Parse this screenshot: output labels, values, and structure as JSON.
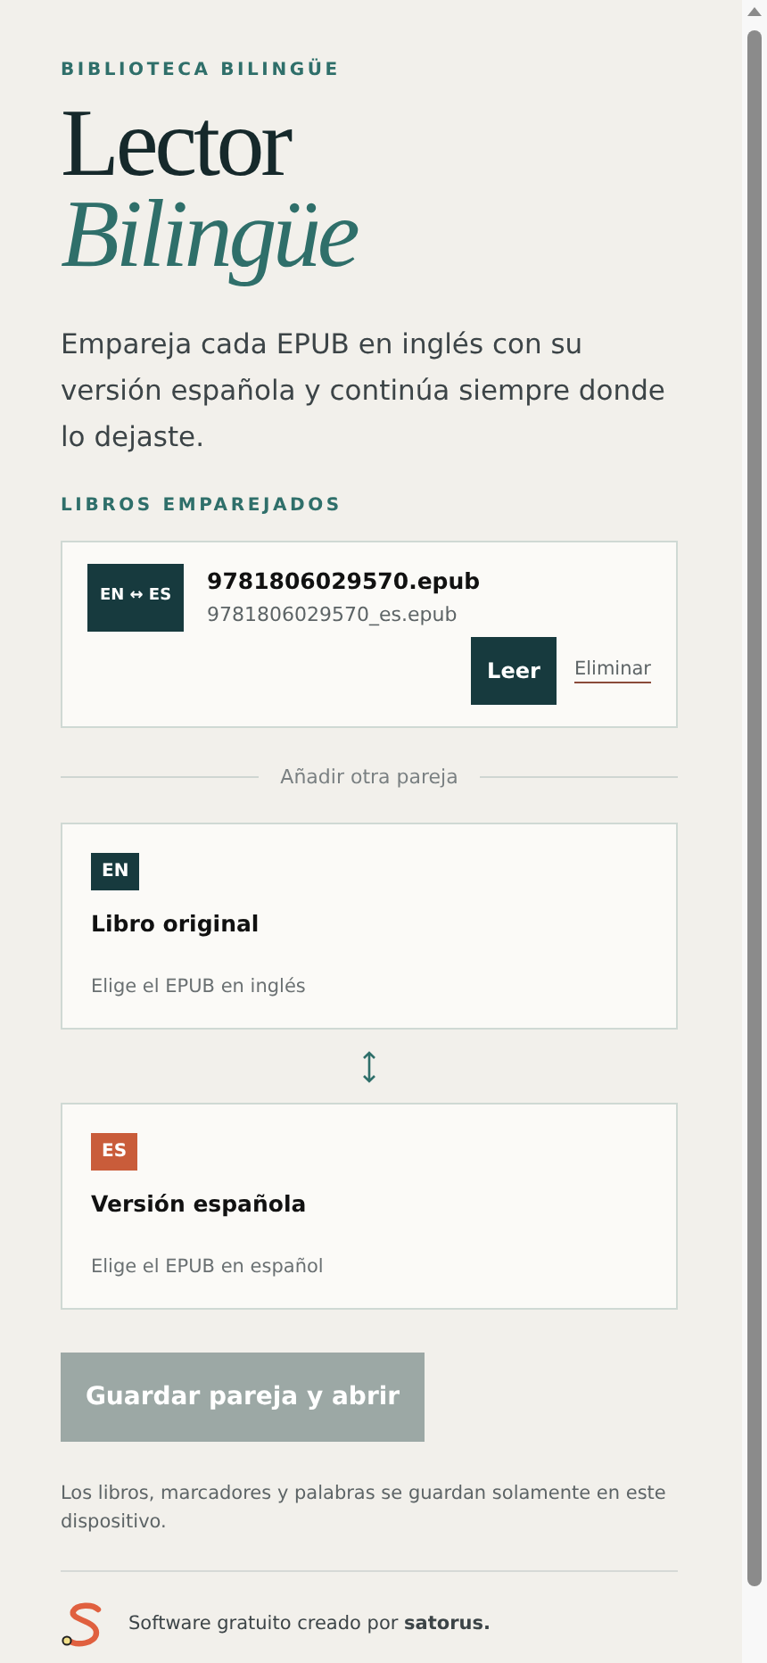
{
  "eyebrow": "BIBLIOTECA BILINGÜE",
  "title": {
    "line_1": "Lector",
    "line_2": "Bilingüe"
  },
  "intro": "Empareja cada EPUB en inglés con su versión española y continúa siempre donde lo dejaste.",
  "paired_heading": "LIBROS EMPAREJADOS",
  "pairs": [
    {
      "badge": "EN ↔ ES",
      "original": "9781806029570.epub",
      "translation": "9781806029570_es.epub",
      "read_button": "Leer",
      "delete_link": "Eliminar"
    }
  ],
  "divider_label": "Añadir otra pareja",
  "drop_zones": [
    {
      "badge": "EN",
      "color": "#173a3e",
      "title": "Libro original",
      "hint": "Elige el EPUB en inglés"
    },
    {
      "badge": "ES",
      "color": "#c95c3a",
      "title": "Versión española",
      "hint": "Elige el EPUB en español"
    }
  ],
  "save_button": {
    "label": "Guardar pareja y abrir",
    "disabled": true
  },
  "storage_note": "Los libros, marcadores y palabras se guardan solamente en este dispositivo.",
  "footer": {
    "text": "Software gratuito creado por **satorus.**"
  }
}
